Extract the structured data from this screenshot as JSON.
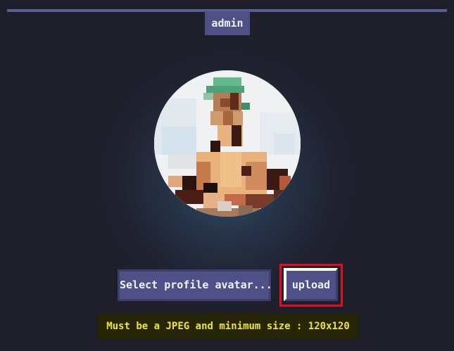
{
  "profile": {
    "username": "admin"
  },
  "avatar": {
    "description": "pixelated profile avatar"
  },
  "actions": {
    "select_label": "Select profile avatar...",
    "upload_label": "upload"
  },
  "hint": {
    "text": "Must be a JPEG and minimum size : 120x120"
  },
  "colors": {
    "background": "#1f1f2b",
    "accent": "#4e5087",
    "highlight": "#e0101a",
    "hint_text": "#f0e430"
  }
}
